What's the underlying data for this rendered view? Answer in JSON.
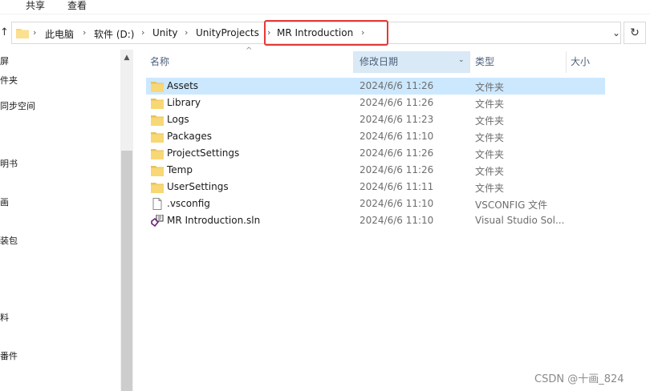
{
  "ribbon": {
    "share": "共享",
    "view": "查看"
  },
  "address": {
    "crumbs": [
      "此电脑",
      "软件 (D:)",
      "Unity",
      "UnityProjects",
      "MR Introduction"
    ],
    "separator": "›"
  },
  "sidebar": {
    "items": [
      "屏",
      "件夹",
      "同步空间",
      "明书",
      "画",
      "装包",
      "料",
      "番件"
    ]
  },
  "columns": {
    "name": "名称",
    "date": "修改日期",
    "type": "类型",
    "size": "大小"
  },
  "files": [
    {
      "name": "Assets",
      "date": "2024/6/6 11:26",
      "type": "文件夹",
      "icon": "folder-icon"
    },
    {
      "name": "Library",
      "date": "2024/6/6 11:26",
      "type": "文件夹",
      "icon": "folder-icon"
    },
    {
      "name": "Logs",
      "date": "2024/6/6 11:23",
      "type": "文件夹",
      "icon": "folder-icon"
    },
    {
      "name": "Packages",
      "date": "2024/6/6 11:10",
      "type": "文件夹",
      "icon": "folder-icon"
    },
    {
      "name": "ProjectSettings",
      "date": "2024/6/6 11:26",
      "type": "文件夹",
      "icon": "folder-icon"
    },
    {
      "name": "Temp",
      "date": "2024/6/6 11:26",
      "type": "文件夹",
      "icon": "folder-icon"
    },
    {
      "name": "UserSettings",
      "date": "2024/6/6 11:11",
      "type": "文件夹",
      "icon": "folder-icon"
    },
    {
      "name": ".vsconfig",
      "date": "2024/6/6 11:10",
      "type": "VSCONFIG 文件",
      "icon": "file-icon"
    },
    {
      "name": "MR Introduction.sln",
      "date": "2024/6/6 11:10",
      "type": "Visual Studio Sol...",
      "icon": "visual-studio-solution-icon"
    }
  ],
  "watermark": "CSDN @十画_824",
  "colors": {
    "highlight": "#e53935",
    "selected_row": "#cce8ff",
    "sorted_header": "#d9e9f6",
    "folder": "#f8d775"
  }
}
